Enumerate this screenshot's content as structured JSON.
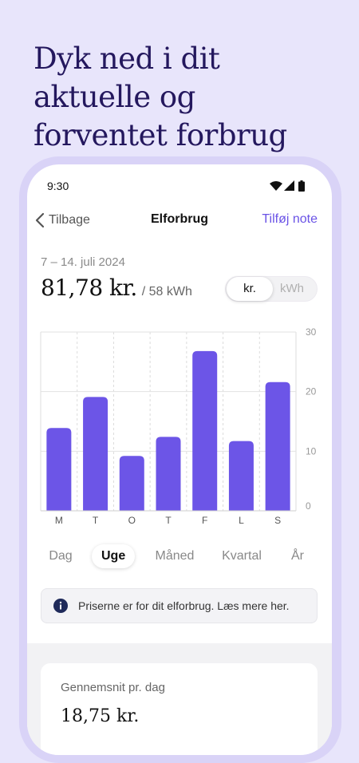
{
  "headline": "Dyk ned i dit aktuelle og forventet forbrug",
  "status": {
    "time": "9:30",
    "icons": [
      "wifi-icon",
      "signal-icon",
      "battery-icon"
    ]
  },
  "nav": {
    "back_label": "Tilbage",
    "title": "Elforbrug",
    "action_label": "Tilføj note"
  },
  "summary": {
    "date_range": "7 – 14. juli 2024",
    "amount": "81,78 kr.",
    "sub": "/ 58 kWh"
  },
  "unit_toggle": {
    "options": [
      "kr.",
      "kWh"
    ],
    "selected": "kr."
  },
  "chart_data": {
    "type": "bar",
    "categories": [
      "M",
      "T",
      "O",
      "T",
      "F",
      "L",
      "S"
    ],
    "values": [
      13.9,
      19.1,
      9.2,
      12.4,
      26.8,
      11.7,
      21.6
    ],
    "ylim": [
      0,
      30
    ],
    "yticks": [
      0,
      10,
      20,
      30
    ],
    "title": "",
    "xlabel": "",
    "ylabel": "",
    "bar_color": "#6c55e7",
    "grid": true
  },
  "period_tabs": {
    "items": [
      "Dag",
      "Uge",
      "Måned",
      "Kvartal",
      "År"
    ],
    "selected": "Uge"
  },
  "info": {
    "text": "Priserne er for dit elforbrug. Læs mere her.",
    "icon": "info-icon"
  },
  "card": {
    "label": "Gennemsnit pr. dag",
    "value": "18,75 kr."
  },
  "colors": {
    "background": "#e8e5fb",
    "headline": "#24185e",
    "accent": "#6a53e6",
    "bar": "#6c55e7",
    "info_icon": "#1f2a5a"
  }
}
